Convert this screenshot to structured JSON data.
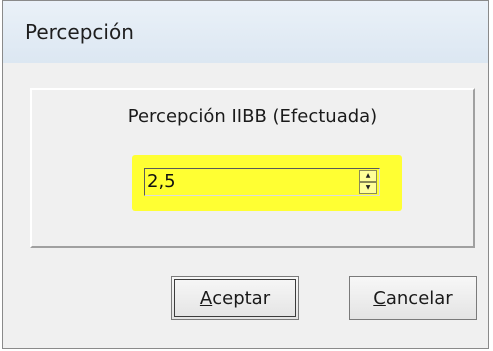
{
  "window": {
    "title": "Percepción"
  },
  "panel": {
    "label": "Percepción IIBB (Efectuada)",
    "input_value": "2,5",
    "highlight_color": "#ffff33"
  },
  "buttons": {
    "accept_hotkey": "A",
    "accept_rest": "ceptar",
    "cancel_hotkey": "C",
    "cancel_rest": "ancelar"
  }
}
